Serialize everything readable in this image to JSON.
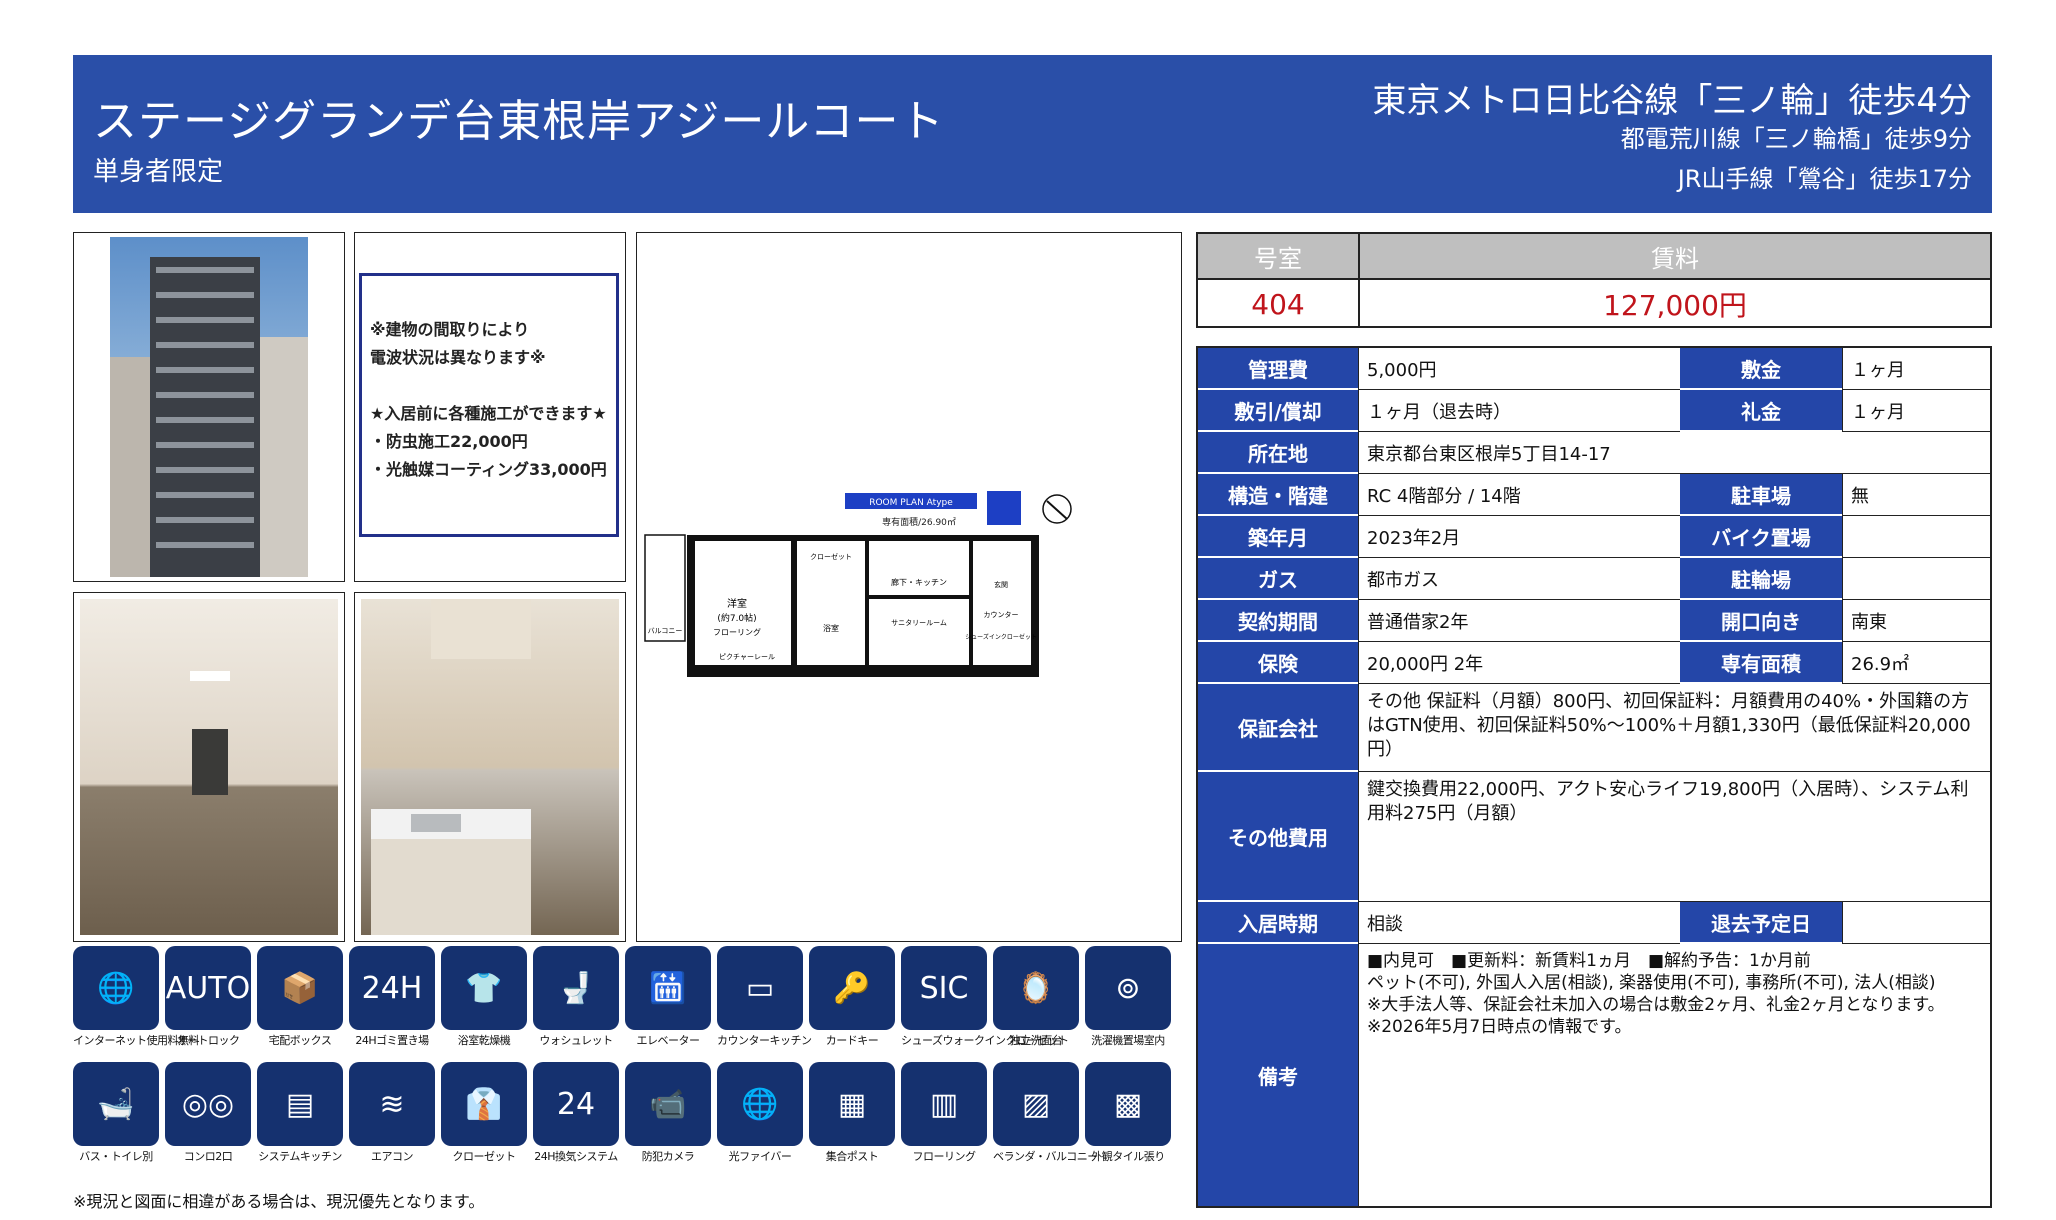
{
  "header": {
    "title": "ステージグランデ台東根岸アジールコート",
    "subtitle": "単身者限定",
    "station1": "東京メトロ日比谷線「三ノ輪」徒歩4分",
    "station2": "都電荒川線「三ノ輪橋」徒歩9分",
    "station3": "JR山手線「鶯谷」徒歩17分",
    "bg_color": "#2a4fa8"
  },
  "notice": {
    "line1": "※建物の間取りにより",
    "line2": "電波状況は異なります※",
    "line3": "★入居前に各種施工ができます★",
    "line4": "・防虫施工22,000円",
    "line5": "・光触媒コーティング33,000円"
  },
  "floorplan": {
    "plan_label": "ROOM PLAN  Atype",
    "area": "専有面積/26.90㎡",
    "room": "洋室",
    "room_size": "(約7.0帖)",
    "flooring": "フローリング",
    "kitchen": "廊下・キッチン",
    "bath": "浴室",
    "sanitary": "サニタリールーム",
    "balcony": "バルコニー",
    "entrance": "玄関",
    "counter": "カウンター",
    "shoes": "シューズインクローゼット",
    "closet": "クローゼット",
    "picture_rail": "ピクチャーレール"
  },
  "amenities": [
    {
      "label": "インターネット使用料無料",
      "icon": "globe-icon",
      "glyph": "🌐"
    },
    {
      "label": "オートロック",
      "icon": "autolock-icon",
      "glyph": "AUTO"
    },
    {
      "label": "宅配ボックス",
      "icon": "delivery-box-icon",
      "glyph": "📦"
    },
    {
      "label": "24Hゴミ置き場",
      "icon": "trash-24h-icon",
      "glyph": "24H"
    },
    {
      "label": "浴室乾燥機",
      "icon": "bath-dryer-icon",
      "glyph": "👕"
    },
    {
      "label": "ウォシュレット",
      "icon": "washlet-icon",
      "glyph": "🚽"
    },
    {
      "label": "エレベーター",
      "icon": "elevator-icon",
      "glyph": "🛗"
    },
    {
      "label": "カウンターキッチン",
      "icon": "counter-kitchen-icon",
      "glyph": "▭"
    },
    {
      "label": "カードキー",
      "icon": "card-key-icon",
      "glyph": "🔑"
    },
    {
      "label": "シューズウォークインクローゼット",
      "icon": "sic-icon",
      "glyph": "SIC"
    },
    {
      "label": "独立洗面台",
      "icon": "vanity-icon",
      "glyph": "🪞"
    },
    {
      "label": "洗濯機置場室内",
      "icon": "washer-icon",
      "glyph": "⊚"
    },
    {
      "label": "バス・トイレ別",
      "icon": "bath-toilet-icon",
      "glyph": "🛁"
    },
    {
      "label": "コンロ2口",
      "icon": "stove-icon",
      "glyph": "◎◎"
    },
    {
      "label": "システムキッチン",
      "icon": "system-kitchen-icon",
      "glyph": "▤"
    },
    {
      "label": "エアコン",
      "icon": "aircon-icon",
      "glyph": "≋"
    },
    {
      "label": "クローゼット",
      "icon": "closet-icon",
      "glyph": "👔"
    },
    {
      "label": "24H換気システム",
      "icon": "ventilation-icon",
      "glyph": "24"
    },
    {
      "label": "防犯カメラ",
      "icon": "camera-icon",
      "glyph": "📹"
    },
    {
      "label": "光ファイバー",
      "icon": "fiber-icon",
      "glyph": "🌐"
    },
    {
      "label": "集合ポスト",
      "icon": "mailbox-icon",
      "glyph": "▦"
    },
    {
      "label": "フローリング",
      "icon": "flooring-icon",
      "glyph": "▥"
    },
    {
      "label": "ベランダ・バルコニー",
      "icon": "balcony-icon",
      "glyph": "▨"
    },
    {
      "label": "外観タイル張り",
      "icon": "tile-icon",
      "glyph": "▩"
    }
  ],
  "footnote": "※現況と図面に相違がある場合は、現況優先となります。",
  "rent": {
    "room_label": "号室",
    "rent_label": "賃料",
    "room_value": "404",
    "rent_value": "127,000円"
  },
  "info": {
    "kanri_label": "管理費",
    "kanri": "5,000円",
    "shikikin_label": "敷金",
    "shikikin": "１ヶ月",
    "shikibiki_label": "敷引/償却",
    "shikibiki": "１ヶ月（退去時）",
    "reikin_label": "礼金",
    "reikin": "１ヶ月",
    "address_label": "所在地",
    "address": "東京都台東区根岸5丁目14-17",
    "structure_label": "構造・階建",
    "structure": "RC 4階部分 / 14階",
    "parking_label": "駐車場",
    "parking": "無",
    "built_label": "築年月",
    "built": "2023年2月",
    "bike_label": "バイク置場",
    "bike": "",
    "gas_label": "ガス",
    "gas": "都市ガス",
    "bicycle_label": "駐輪場",
    "bicycle": "",
    "contract_label": "契約期間",
    "contract": "普通借家2年",
    "facing_label": "開口向き",
    "facing": "南東",
    "insurance_label": "保険",
    "insurance": "20,000円 2年",
    "area_label": "専有面積",
    "area": "26.9㎡",
    "guarantee_label": "保証会社",
    "guarantee": "その他 保証料（月額）800円、初回保証料：月額費用の40%・外国籍の方はGTN使用、初回保証料50%～100%＋月額1,330円（最低保証料20,000円）",
    "other_label": "その他費用",
    "other": "鍵交換費用22,000円、アクト安心ライフ19,800円（入居時）、システム利用料275円（月額）",
    "movein_label": "入居時期",
    "movein": "相談",
    "moveout_label": "退去予定日",
    "moveout": "",
    "remarks_label": "備考",
    "remarks1": "■内見可　■更新料：新賃料1ヵ月　■解約予告：1か月前",
    "remarks2": "ペット(不可), 外国人入居(相談), 楽器使用(不可), 事務所(不可), 法人(相談)",
    "remarks3": "※大手法人等、保証会社未加入の場合は敷金2ヶ月、礼金2ヶ月となります。",
    "remarks4": "※2026年5月7日時点の情報です。"
  }
}
